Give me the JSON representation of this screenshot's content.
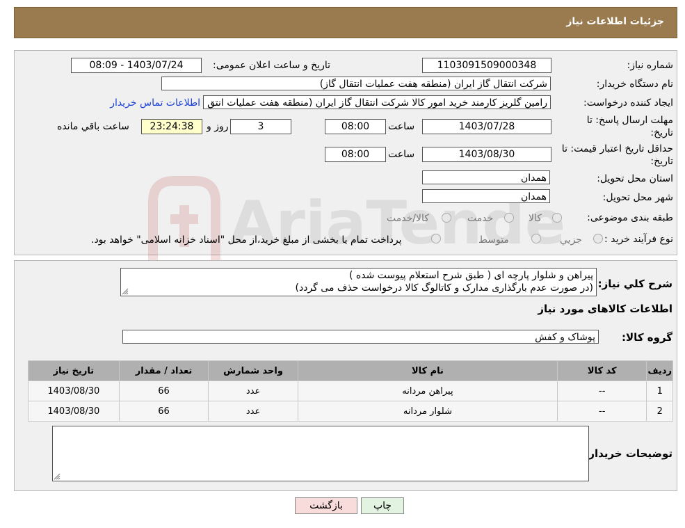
{
  "header": {
    "title": "جزئیات اطلاعات نیاز"
  },
  "form": {
    "need_number": {
      "label": "شماره نیاز:",
      "value": "1103091509000348"
    },
    "announce": {
      "label": "تاریخ و ساعت اعلان عمومی:",
      "value": "1403/07/24 - 08:09"
    },
    "buyer_org": {
      "label": "نام دستگاه خریدار:",
      "value": "شرکت انتقال گاز ایران (منطقه هفت عملیات انتقال گاز)"
    },
    "requester": {
      "label": "ایجاد کننده درخواست:",
      "value": "رامین گلریز کارمند خرید امور کالا شرکت انتقال گاز ایران (منطقه هفت عملیات انتق",
      "contact_link": "اطلاعات تماس خریدار"
    },
    "reply_deadline": {
      "label_line1": "مهلت ارسال پاسخ: تا",
      "label_line2": "تاریخ:",
      "date": "1403/07/28",
      "time_label": "ساعت",
      "time": "08:00",
      "days": "3",
      "days_label": "روز و",
      "remaining": "23:24:38",
      "remaining_label": "ساعت باقي مانده"
    },
    "price_validity": {
      "label_line1": "حداقل تاریخ اعتبار قیمت: تا",
      "label_line2": "تاریخ:",
      "date": "1403/08/30",
      "time_label": "ساعت",
      "time": "08:00"
    },
    "province": {
      "label": "استان محل تحویل:",
      "value": "همدان"
    },
    "city": {
      "label": "شهر محل تحویل:",
      "value": "همدان"
    },
    "category": {
      "label": "طبقه بندی موضوعی:",
      "options": [
        "کالا",
        "خدمت",
        "کالا/خدمت"
      ]
    },
    "purchase_type": {
      "label": "نوع فرآیند خرید :",
      "options": [
        "جزیي",
        "متوسط"
      ],
      "note": "پرداخت تمام یا بخشی از مبلغ خرید،از محل \"اسناد خزانه اسلامی\" خواهد بود."
    }
  },
  "details": {
    "description_label": "شرح كلي نياز:",
    "description_line1": "پیراهن و شلوار پارچه ای ( طبق شرح استعلام پیوست شده )",
    "description_line2": "(در صورت عدم بارگذاری مدارک و کاتالوگ کالا درخواست حذف می گردد)",
    "items_title": "اطلاعات کالاهای مورد نیاز",
    "group_label": "گروه کالا:",
    "group_value": "پوشاک و کفش",
    "table": {
      "headers": [
        "ردیف",
        "کد کالا",
        "نام کالا",
        "واحد شمارش",
        "تعداد / مقدار",
        "تاریخ نیاز"
      ],
      "rows": [
        [
          "1",
          "--",
          "پیراهن مردانه",
          "عدد",
          "66",
          "1403/08/30"
        ],
        [
          "2",
          "--",
          "شلوار مردانه",
          "عدد",
          "66",
          "1403/08/30"
        ]
      ]
    },
    "buyer_notes_label": "توضیحات خریدار:"
  },
  "buttons": {
    "print": "چاپ",
    "back": "بازگشت"
  },
  "watermark": {
    "text": "AriaTender.neT"
  },
  "colors": {
    "header_bg": "#9a7b4f",
    "link": "#1a3fd6",
    "back_button": "#f8dcdc",
    "print_button": "#e2f3e2",
    "remaining_bg": "#ffffcc"
  }
}
